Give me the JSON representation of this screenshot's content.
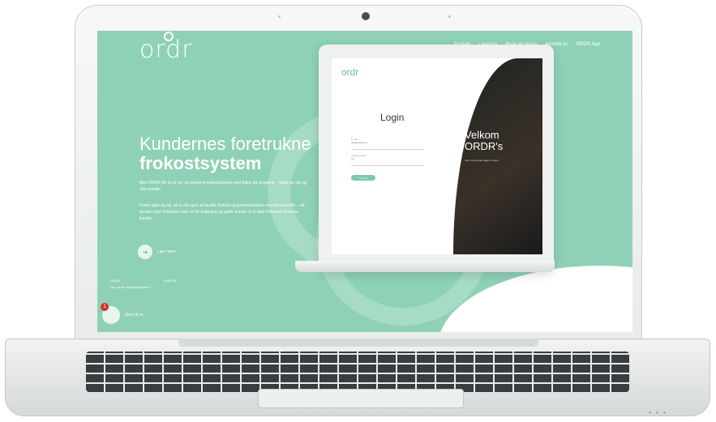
{
  "site": {
    "logo": "ordr",
    "nav": [
      "Produkt",
      "Levering",
      "Book en demo",
      "Anmeld os",
      "ORDR App"
    ],
    "hero": {
      "title_line1": "Kundernes foretrukne",
      "title_line2": "frokostsystem",
      "para1": "Med ORDR får du et nyt og moderne frokostsystem med fokus på brugerne – både for dig og dine kunder.",
      "para2": "Hvem siger du så, så er det sjovt at bestille frokost og kommunikation med dine kunder – så de kan nyde frokosten med en fin betjening og glade kunder til at køre frokosten til deres kunder.",
      "cta_label": "Læs mere"
    },
    "small_row_left": "ORDR",
    "small_row_mid": "ORDR ⊕",
    "small_row_sub": "Har du set frokostsystemet?",
    "chat_badge": "1",
    "chat_label": "Skriv til os"
  },
  "mockup": {
    "logo": "ordr",
    "login_title": "Login",
    "email_label": "E-mail",
    "email_value": "din@email.com",
    "password_label": "Adgangskode",
    "password_value": "••••",
    "login_button": "Log ind",
    "welcome_line1": "Velkom",
    "welcome_line2": "ORDR's",
    "welcome_sub": "Klar til at bestille dagens frokost"
  },
  "colors": {
    "accent": "#8ed1b7",
    "button": "#7dc7ab",
    "chat_badge": "#d9312b"
  }
}
